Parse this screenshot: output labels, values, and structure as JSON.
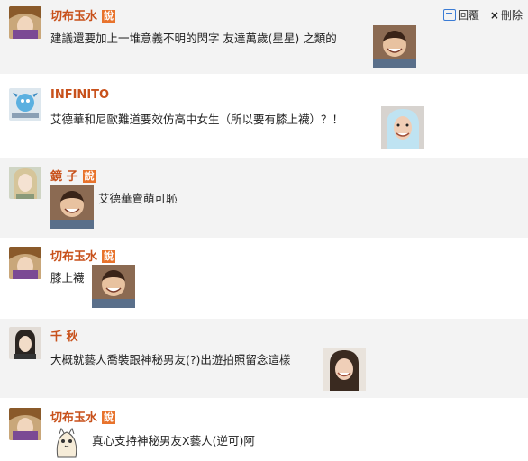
{
  "actions": {
    "reply_label": "回覆",
    "delete_label": "刪除"
  },
  "say_badge": "說",
  "comments": [
    {
      "user": "切布玉水",
      "has_badge": true,
      "text": "建議還要加上一堆意義不明的閃字 友達萬歲(星星) 之類的"
    },
    {
      "user": "INFINITO",
      "has_badge": false,
      "text": "艾德華和尼歐難道要效仿高中女生（所以要有膝上襪）？！"
    },
    {
      "user": "鏡 子",
      "has_badge": true,
      "text": "艾德華賣萌可恥"
    },
    {
      "user": "切布玉水",
      "has_badge": true,
      "text": "膝上襪"
    },
    {
      "user": "千 秋",
      "has_badge": false,
      "text": "大概就藝人喬裝跟神秘男友(?)出遊拍照留念這樣"
    },
    {
      "user": "切布玉水",
      "has_badge": true,
      "text": "真心支持神秘男友X藝人(逆可)阿"
    }
  ]
}
